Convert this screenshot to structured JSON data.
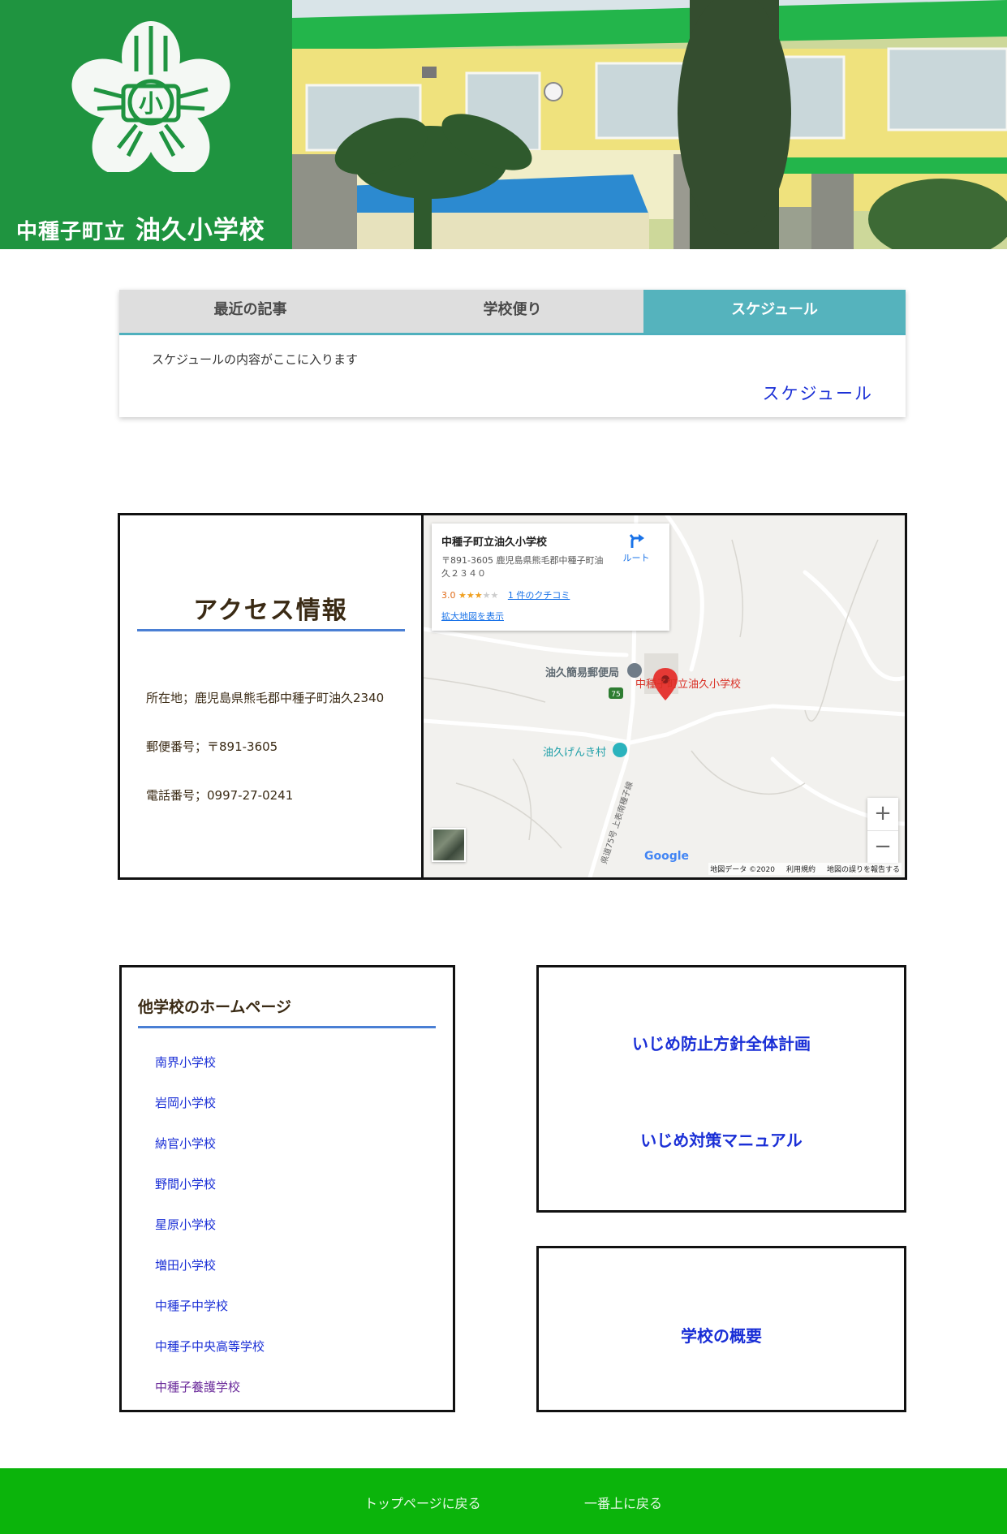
{
  "header": {
    "logo_town": "中種子町立",
    "logo_school": "油久小学校",
    "logo_emblem_text": "小",
    "brand_color": "#1f9440",
    "emblem_icon": "sakura-emblem-icon"
  },
  "tabs": {
    "items": [
      {
        "label": "最近の記事",
        "active": false
      },
      {
        "label": "学校便り",
        "active": false
      },
      {
        "label": "スケジュール",
        "active": true
      }
    ],
    "active_color": "#55b3bd",
    "content_text": "スケジュールの内容がここに入ります",
    "more_link": "スケジュール"
  },
  "access": {
    "title": "アクセス情報",
    "address": "所在地；鹿児島県熊毛郡中種子町油久2340",
    "postal": "郵便番号；〒891-3605",
    "phone": "電話番号；0997-27-0241"
  },
  "map": {
    "card_title": "中種子町立油久小学校",
    "card_address": "〒891-3605 鹿児島県熊毛郡中種子町油久２３４０",
    "rating": "3.0",
    "stars_filled": 3,
    "stars_empty": 2,
    "reviews": "1 件のクチコミ",
    "larger_map": "拡大地図を表示",
    "route": "ルート",
    "pin_label": "中種子町立油久小学校",
    "post_office": "油久簡易郵便局",
    "genki_village": "油久げんき村",
    "road_number": "75",
    "road_name": "県道75号 上表南種子線",
    "zoom_in": "+",
    "zoom_out": "−",
    "google": "Google",
    "attribution": "地図データ ©2020",
    "terms": "利用規約",
    "report": "地図の誤りを報告する"
  },
  "schools": {
    "title": "他学校のホームページ",
    "links": [
      "南界小学校",
      "岩岡小学校",
      "納官小学校",
      "野間小学校",
      "星原小学校",
      "増田小学校",
      "中種子中学校",
      "中種子中央高等学校",
      "中種子養護学校"
    ]
  },
  "bullying": {
    "policy": "いじめ防止方針全体計画",
    "manual": "いじめ対策マニュアル"
  },
  "overview": {
    "link": "学校の概要"
  },
  "footer": {
    "top_page": "トップページに戻る",
    "back_to_top": "一番上に戻る",
    "color": "#0bb40b"
  }
}
